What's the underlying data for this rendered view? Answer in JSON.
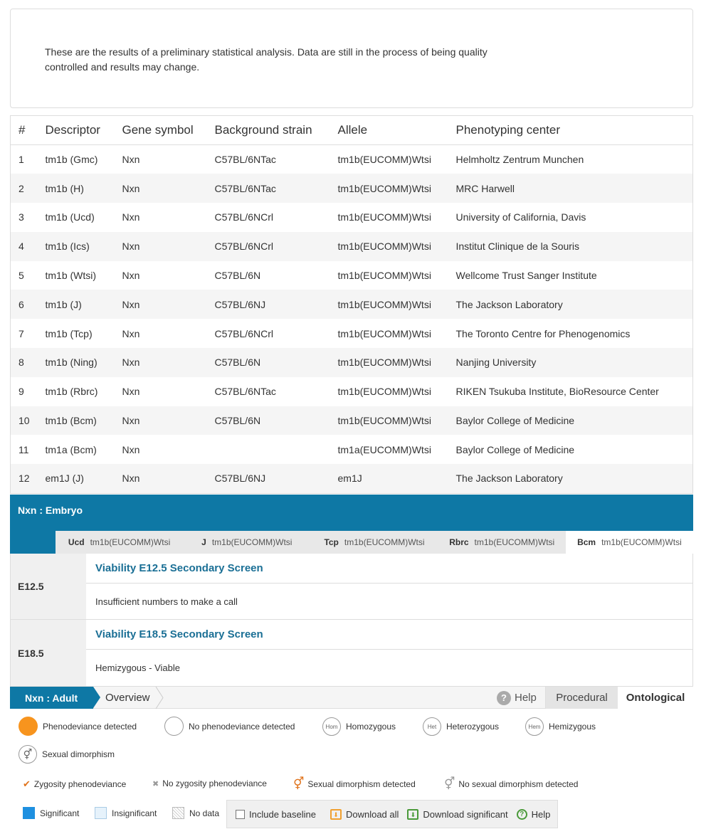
{
  "notice": {
    "text": "These are the results of a preliminary statistical analysis. Data are still in the process of being quality controlled and results may change."
  },
  "table": {
    "headers": [
      "#",
      "Descriptor",
      "Gene symbol",
      "Background strain",
      "Allele",
      "Phenotyping center"
    ],
    "rows": [
      [
        "1",
        "tm1b (Gmc)",
        "Nxn",
        "C57BL/6NTac",
        "tm1b(EUCOMM)Wtsi",
        "Helmholtz Zentrum Munchen"
      ],
      [
        "2",
        "tm1b (H)",
        "Nxn",
        "C57BL/6NTac",
        "tm1b(EUCOMM)Wtsi",
        "MRC Harwell"
      ],
      [
        "3",
        "tm1b (Ucd)",
        "Nxn",
        "C57BL/6NCrl",
        "tm1b(EUCOMM)Wtsi",
        "University of California, Davis"
      ],
      [
        "4",
        "tm1b (Ics)",
        "Nxn",
        "C57BL/6NCrl",
        "tm1b(EUCOMM)Wtsi",
        "Institut Clinique de la Souris"
      ],
      [
        "5",
        "tm1b (Wtsi)",
        "Nxn",
        "C57BL/6N",
        "tm1b(EUCOMM)Wtsi",
        "Wellcome Trust Sanger Institute"
      ],
      [
        "6",
        "tm1b (J)",
        "Nxn",
        "C57BL/6NJ",
        "tm1b(EUCOMM)Wtsi",
        "The Jackson Laboratory"
      ],
      [
        "7",
        "tm1b (Tcp)",
        "Nxn",
        "C57BL/6NCrl",
        "tm1b(EUCOMM)Wtsi",
        "The Toronto Centre for Phenogenomics"
      ],
      [
        "8",
        "tm1b (Ning)",
        "Nxn",
        "C57BL/6N",
        "tm1b(EUCOMM)Wtsi",
        "Nanjing University"
      ],
      [
        "9",
        "tm1b (Rbrc)",
        "Nxn",
        "C57BL/6NTac",
        "tm1b(EUCOMM)Wtsi",
        "RIKEN Tsukuba Institute, BioResource Center"
      ],
      [
        "10",
        "tm1b (Bcm)",
        "Nxn",
        "C57BL/6N",
        "tm1b(EUCOMM)Wtsi",
        "Baylor College of Medicine"
      ],
      [
        "11",
        "tm1a (Bcm)",
        "Nxn",
        "",
        "tm1a(EUCOMM)Wtsi",
        "Baylor College of Medicine"
      ],
      [
        "12",
        "em1J (J)",
        "Nxn",
        "C57BL/6NJ",
        "em1J",
        "The Jackson Laboratory"
      ]
    ]
  },
  "embryo": {
    "title": "Nxn : Embryo",
    "tabs": [
      {
        "center": "Ucd",
        "allele": "tm1b(EUCOMM)Wtsi"
      },
      {
        "center": "J",
        "allele": "tm1b(EUCOMM)Wtsi"
      },
      {
        "center": "Tcp",
        "allele": "tm1b(EUCOMM)Wtsi"
      },
      {
        "center": "Rbrc",
        "allele": "tm1b(EUCOMM)Wtsi"
      },
      {
        "center": "Bcm",
        "allele": "tm1b(EUCOMM)Wtsi"
      }
    ],
    "rows": [
      {
        "stage": "E12.5",
        "title": "Viability E12.5 Secondary Screen",
        "text": "Insufficient numbers to make a call"
      },
      {
        "stage": "E18.5",
        "title": "Viability E18.5 Secondary Screen",
        "text": "Hemizygous - Viable"
      }
    ]
  },
  "adult": {
    "title": "Nxn : Adult",
    "overview": "Overview",
    "help": "Help",
    "procedural": "Procedural",
    "ontological": "Ontological"
  },
  "legend": {
    "phenodeviance": "Phenodeviance detected",
    "no_phenodeviance": "No phenodeviance detected",
    "hom_icon": "Hom",
    "homozygous": "Homozygous",
    "het_icon": "Het",
    "heterozygous": "Heterozygous",
    "hem_icon": "Hem",
    "hemizygous": "Hemizygous",
    "sexual_dimorphism": "Sexual dimorphism",
    "zyg_pheno": "Zygosity phenodeviance",
    "no_zyg_pheno": "No zygosity phenodeviance",
    "sd_detected": "Sexual dimorphism detected",
    "no_sd_detected": "No sexual dimorphism detected",
    "significant": "Significant",
    "insignificant": "Insignificant",
    "no_data": "No data"
  },
  "toolbar": {
    "include_baseline": "Include baseline",
    "download_all": "Download all",
    "download_significant": "Download significant",
    "help": "Help"
  },
  "colors": {
    "brand_blue": "#0e78a5",
    "phenodeviance_orange": "#f7941e",
    "significant_blue": "#1e90e0",
    "title_blue": "#1a6f95"
  }
}
